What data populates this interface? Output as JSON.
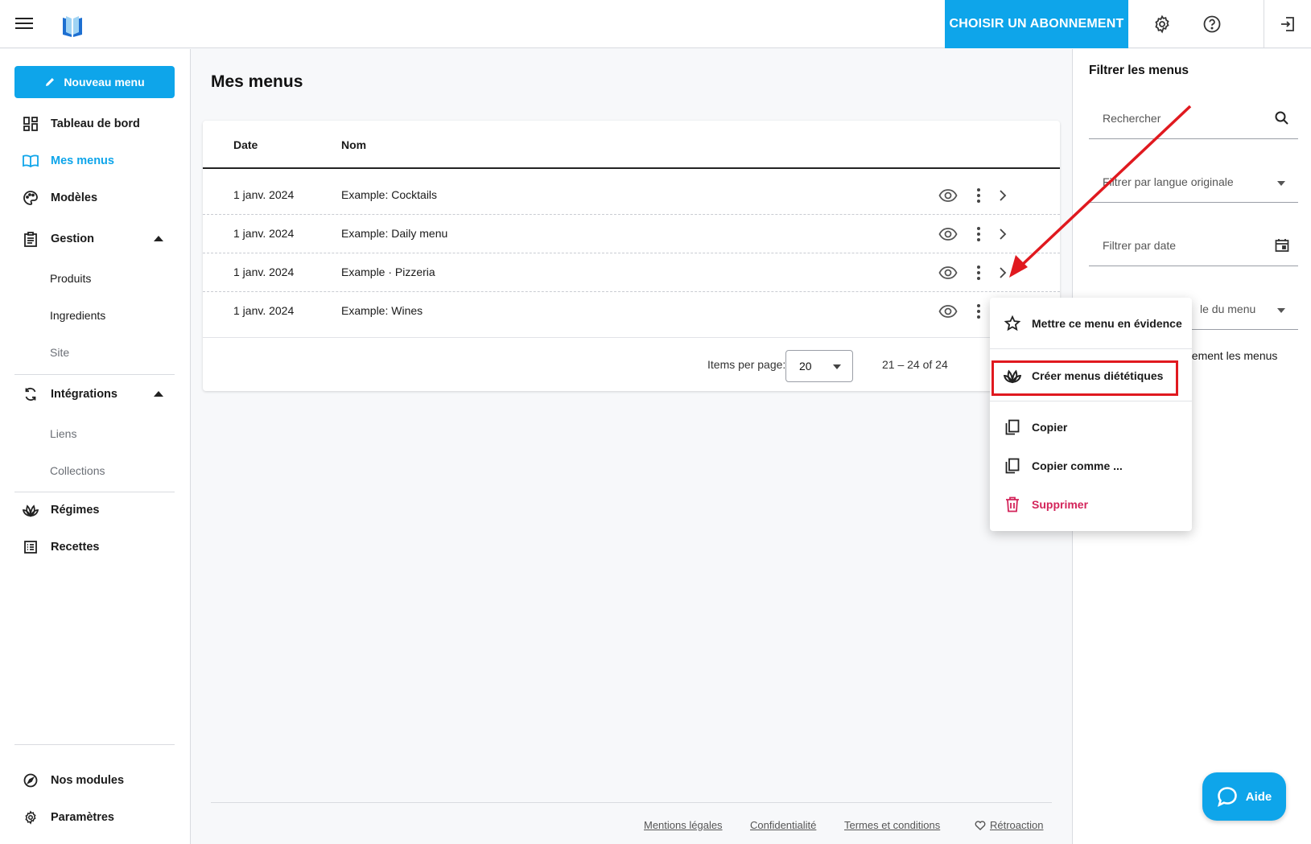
{
  "topbar": {
    "subscribe_label": "CHOISIR UN ABONNEMENT",
    "icons": [
      "menu-icon",
      "logo-icon",
      "settings-icon",
      "help-circle-icon",
      "logout-icon"
    ]
  },
  "sidebar": {
    "new_menu_label": "Nouveau menu",
    "items": {
      "dashboard": "Tableau de bord",
      "my_menus": "Mes menus",
      "templates": "Modèles",
      "management": "Gestion",
      "products": "Produits",
      "ingredients": "Ingredients",
      "site": "Site",
      "integrations": "Intégrations",
      "links": "Liens",
      "collections": "Collections",
      "diets": "Régimes",
      "recipes": "Recettes",
      "modules": "Nos modules",
      "settings": "Paramètres"
    }
  },
  "main": {
    "title": "Mes menus",
    "table": {
      "headers": {
        "date": "Date",
        "name": "Nom"
      },
      "rows": [
        {
          "date": "1 janv. 2024",
          "name": "Example: Cocktails"
        },
        {
          "date": "1 janv. 2024",
          "name": "Example: Daily menu"
        },
        {
          "date": "1 janv. 2024",
          "name": "Example · Pizzeria"
        },
        {
          "date": "1 janv. 2024",
          "name": "Example: Wines"
        }
      ]
    },
    "pagination": {
      "items_per_page_label": "Items per page:",
      "items_per_page_value": "20",
      "range_label": "21 – 24 of 24"
    }
  },
  "context_menu": {
    "feature": "Mettre ce menu en évidence",
    "diet_menus": "Créer menus diététiques",
    "copy": "Copier",
    "copy_as": "Copier comme ...",
    "delete": "Supprimer"
  },
  "filters": {
    "title": "Filtrer les menus",
    "search_placeholder": "Rechercher",
    "language": "Filtrer par langue originale",
    "date": "Filtrer par date",
    "menu_style_partial": "le du menu",
    "only_menus_partial": "uement les menus"
  },
  "footer": {
    "legal": "Mentions légales",
    "privacy": "Confidentialité",
    "terms": "Termes et conditions",
    "feedback": "Rétroaction"
  },
  "help": {
    "label": "Aide"
  },
  "colors": {
    "accent": "#0ea5ea",
    "danger": "#d3245a",
    "annotation": "#e0191f"
  }
}
